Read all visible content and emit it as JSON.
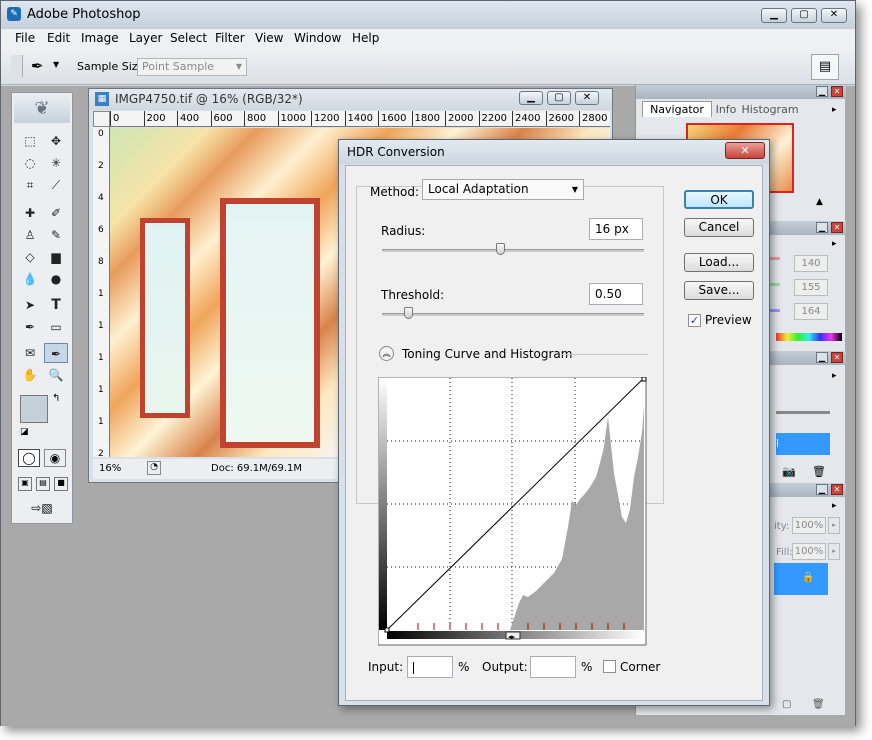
{
  "app": {
    "title": "Adobe Photoshop"
  },
  "menu": [
    "File",
    "Edit",
    "Image",
    "Layer",
    "Select",
    "Filter",
    "View",
    "Window",
    "Help"
  ],
  "options": {
    "sample_size_label": "Sample Size:",
    "sample_size_value": "Point Sample"
  },
  "document": {
    "title": "IMGP4750.tif @ 16% (RGB/32*)",
    "ruler_h": [
      "0",
      "200",
      "400",
      "600",
      "800",
      "1000",
      "1200",
      "1400",
      "1600",
      "1800",
      "2000",
      "2200",
      "2400",
      "2600",
      "2800"
    ],
    "ruler_v": [
      "0",
      "2",
      "4",
      "6",
      "8",
      "1",
      "1",
      "1",
      "1",
      "1",
      "2"
    ],
    "zoom": "16%",
    "doc_info": "Doc: 69.1M/69.1M"
  },
  "panels": {
    "nav_tabs": [
      "Navigator",
      "Info",
      "Histogram"
    ],
    "color_values": [
      "140",
      "155",
      "164"
    ],
    "opacity": "100%",
    "fill": "100%",
    "opacity_label": "ity:",
    "fill_label": "Fill:"
  },
  "dialog": {
    "title": "HDR Conversion",
    "method_label": "Method:",
    "method_value": "Local Adaptation",
    "radius_label": "Radius:",
    "radius_value": "16 px",
    "radius_fraction": 0.45,
    "threshold_label": "Threshold:",
    "threshold_value": "0.50",
    "threshold_fraction": 0.1,
    "curve_section": "Toning Curve and Histogram",
    "ok": "OK",
    "cancel": "Cancel",
    "load": "Load...",
    "save": "Save...",
    "preview_label": "Preview",
    "preview_checked": true,
    "input_label": "Input:",
    "input_value": "",
    "output_label": "Output:",
    "output_value": "",
    "pct": "%",
    "corner_label": "Corner",
    "corner_checked": false
  },
  "colors": {
    "accent": "#3399ff",
    "hist": "#a8a8a8"
  }
}
